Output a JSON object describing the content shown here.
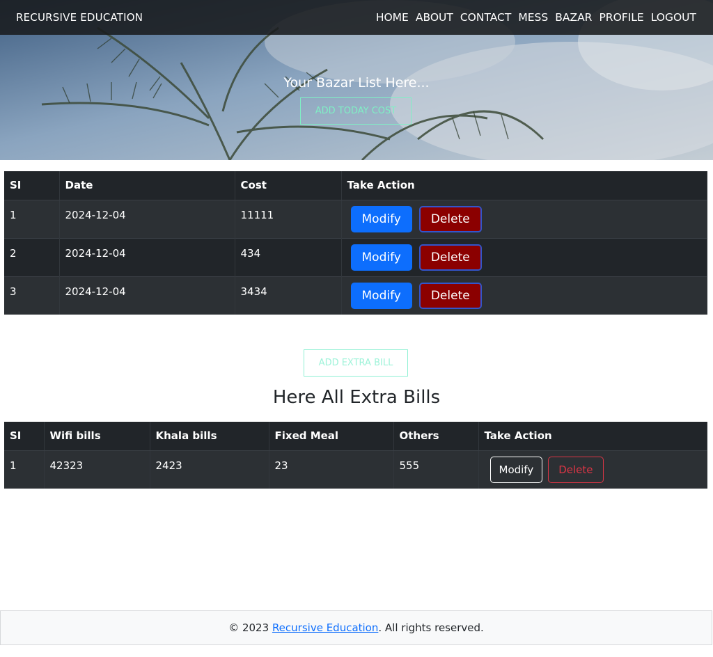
{
  "navbar": {
    "brand": "RECURSIVE EDUCATION",
    "links": [
      "HOME",
      "ABOUT",
      "CONTACT",
      "MESS",
      "BAZAR",
      "PROFILE",
      "LOGOUT"
    ]
  },
  "hero": {
    "title": "Your Bazar List Here...",
    "add_button": "ADD TODAY COST"
  },
  "bazar_table": {
    "headers": [
      "SI",
      "Date",
      "Cost",
      "Take Action"
    ],
    "rows": [
      {
        "si": "1",
        "date": "2024-12-04",
        "cost": "11111"
      },
      {
        "si": "2",
        "date": "2024-12-04",
        "cost": "434"
      },
      {
        "si": "3",
        "date": "2024-12-04",
        "cost": "3434"
      }
    ],
    "modify_label": "Modify",
    "delete_label": "Delete"
  },
  "extra": {
    "add_button": "ADD EXTRA BILL",
    "title": "Here All Extra Bills"
  },
  "extra_table": {
    "headers": [
      "SI",
      "Wifi bills",
      "Khala bills",
      "Fixed Meal",
      "Others",
      "Take Action"
    ],
    "rows": [
      {
        "si": "1",
        "wifi": "42323",
        "khala": "2423",
        "fixed_meal": "23",
        "others": "555"
      }
    ],
    "modify_label": "Modify",
    "delete_label": "Delete"
  },
  "footer": {
    "prefix": "© 2023 ",
    "link": "Recursive Education",
    "suffix": ". All rights reserved."
  },
  "colors": {
    "accent_blue": "#0d6efd",
    "delete_red": "#8b0000",
    "teal_outline": "#7ff0c5",
    "table_dark": "#212529"
  }
}
